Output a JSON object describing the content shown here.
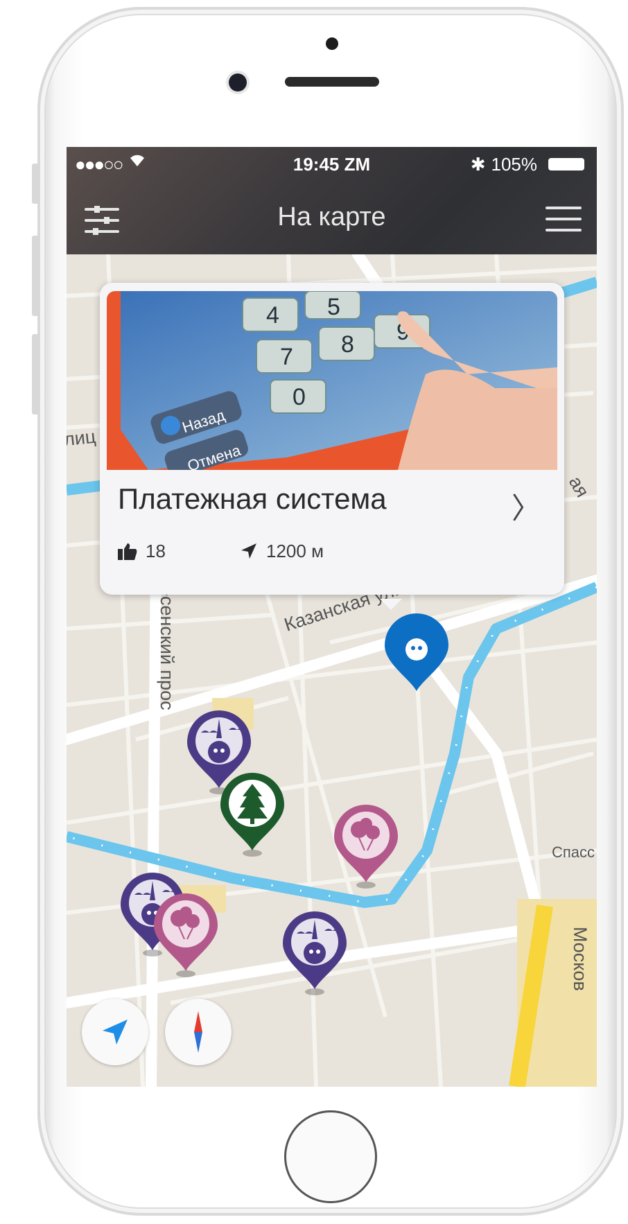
{
  "status_bar": {
    "signal": "●●●○○",
    "time": "19:45 ZM",
    "bluetooth": "✱",
    "battery": "105%"
  },
  "nav": {
    "title": "На карте",
    "filter_icon": "sliders-icon",
    "menu_icon": "hamburger-icon"
  },
  "card": {
    "photo_buttons": {
      "back": "Назад",
      "cancel": "Отмена"
    },
    "keypad_digits": [
      "4",
      "5",
      "7",
      "8",
      "9",
      "0"
    ],
    "title": "Платежная система",
    "arrow": "〉",
    "likes": "18",
    "distance": "1200 м"
  },
  "map_labels": {
    "kazanskaya": "Казанская улица",
    "voznesensky": "Вознесенский прос",
    "ulitsa_left": "лиц",
    "side_right": "ая",
    "spass": "Спасс",
    "moskov": "Москов"
  },
  "colors": {
    "purple": "#4b3b86",
    "pink": "#b2588a",
    "green": "#1d5a2c",
    "blue": "#0d6fc4",
    "canal": "#6bc5ec"
  }
}
